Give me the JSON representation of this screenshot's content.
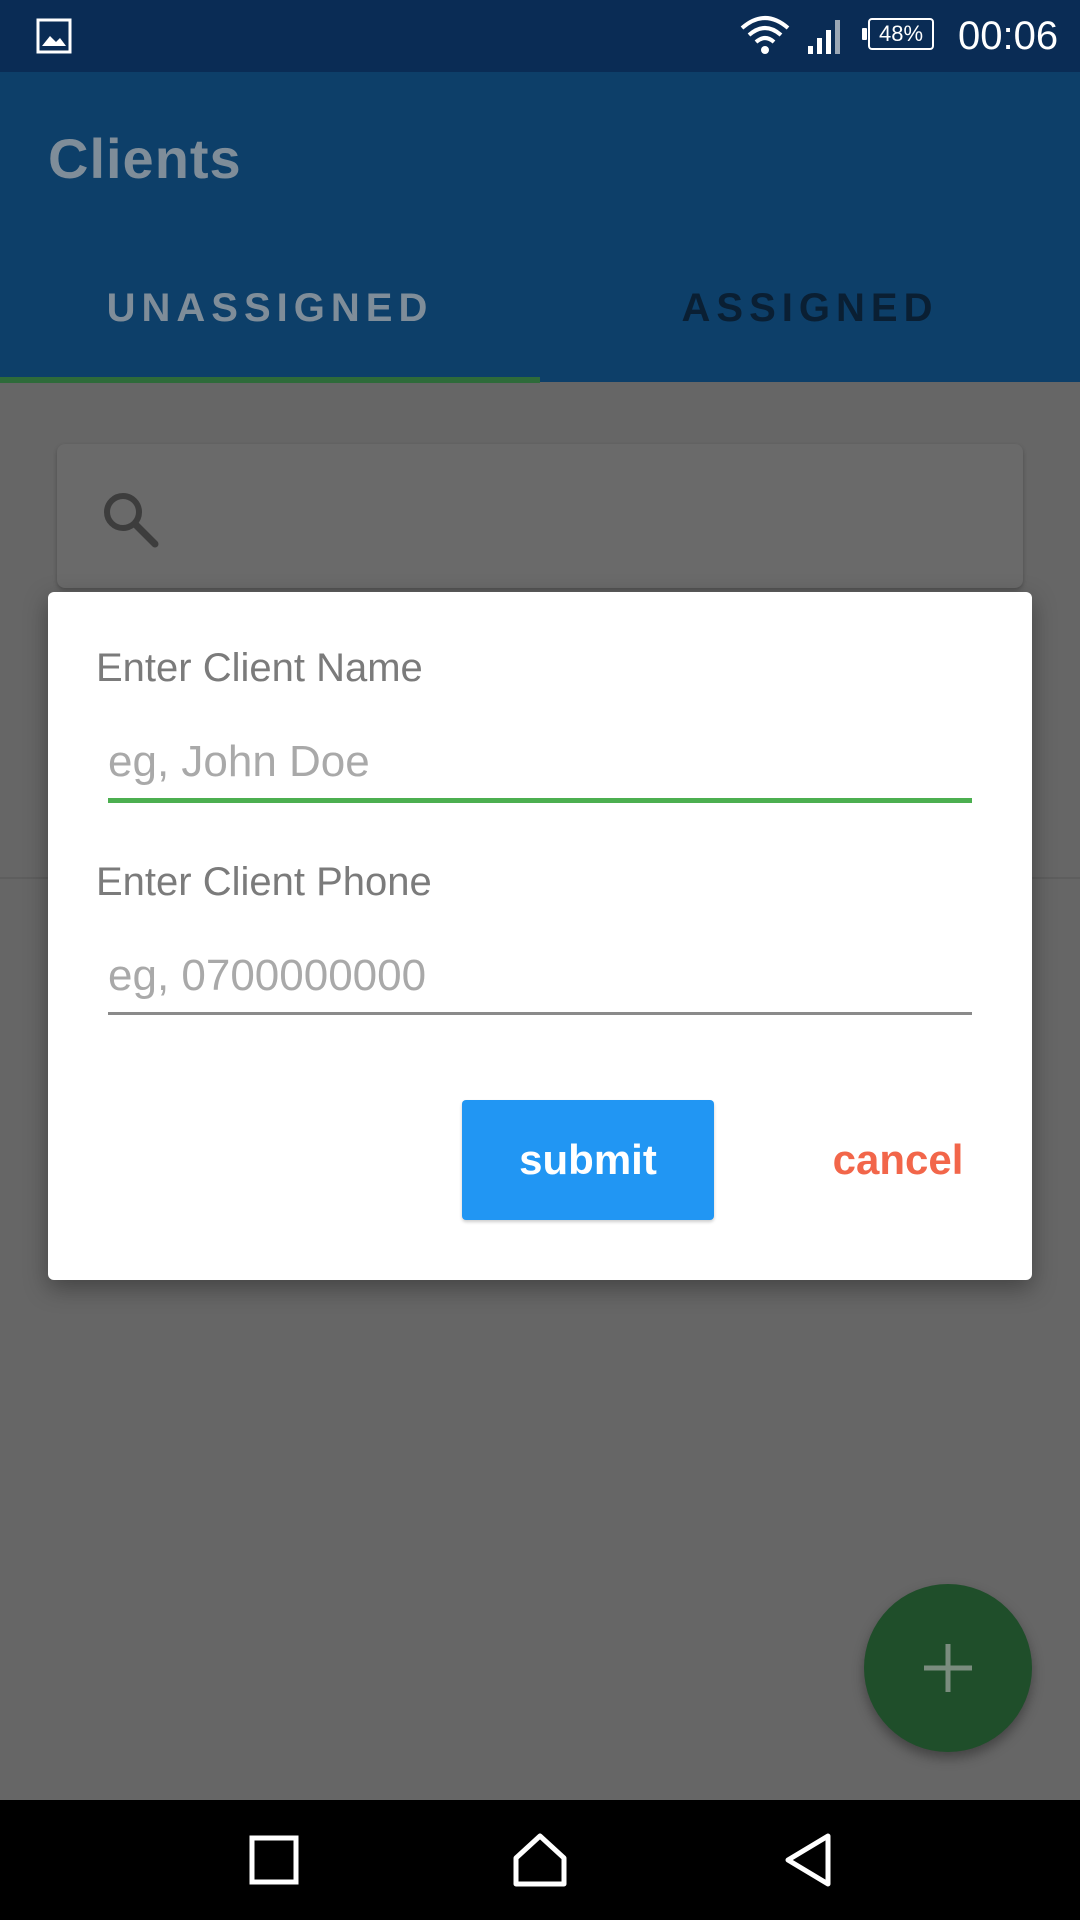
{
  "status_bar": {
    "battery": "48%",
    "time": "00:06",
    "icons": [
      "gallery-icon",
      "wifi-icon",
      "signal-icon",
      "battery-icon"
    ]
  },
  "app_bar": {
    "title": "Clients",
    "tabs": [
      {
        "label": "UNASSIGNED",
        "selected": true
      },
      {
        "label": "ASSIGNED",
        "selected": false
      }
    ]
  },
  "search": {
    "icon": "search-icon"
  },
  "dialog": {
    "name_label": "Enter Client Name",
    "name_placeholder": "eg, John Doe",
    "name_value": "",
    "phone_label": "Enter Client Phone",
    "phone_placeholder": "eg, 0700000000",
    "phone_value": "",
    "submit_label": "submit",
    "cancel_label": "cancel"
  },
  "fab": {
    "icon": "plus-icon"
  },
  "nav_bar": {
    "icons": [
      "recents-icon",
      "home-icon",
      "back-icon"
    ]
  },
  "colors": {
    "status_bar": "#0a2c55",
    "app_bar_dimmed": "#0d3f69",
    "tab_indicator": "#4caf50",
    "submit_button": "#2196f3",
    "cancel_text": "#f2664a",
    "fab": "#2e7d32",
    "scrim_background": "#666666"
  }
}
